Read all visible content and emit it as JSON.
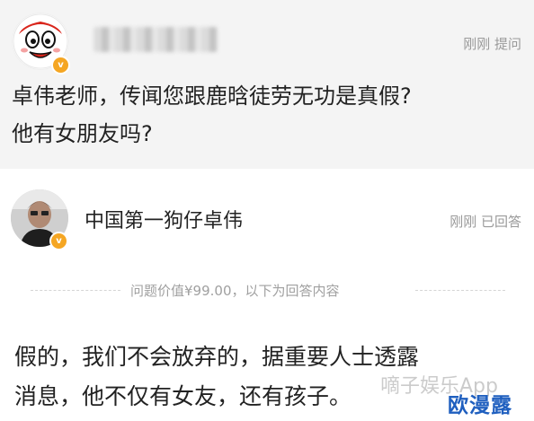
{
  "question": {
    "time": "刚刚",
    "status": "提问",
    "lines": [
      "卓伟老师，传闻您跟鹿晗徒劳无功是真假?",
      "他有女朋友吗?"
    ]
  },
  "answer": {
    "author": "中国第一狗仔卓伟",
    "time": "刚刚",
    "status": "已回答",
    "price_label": "问题价值¥99.00，以下为回答内容",
    "lines": [
      "假的，我们不会放弃的，据重要人士透露",
      "消息，他不仅有女友，还有孩子。"
    ]
  },
  "watermark": {
    "faint": "嘀子娱乐App",
    "brand": "欧漫露"
  },
  "colors": {
    "question_bg": "#f4f4f4",
    "badge": "#f5a623",
    "watermark_brand": "#1f5fbf"
  }
}
